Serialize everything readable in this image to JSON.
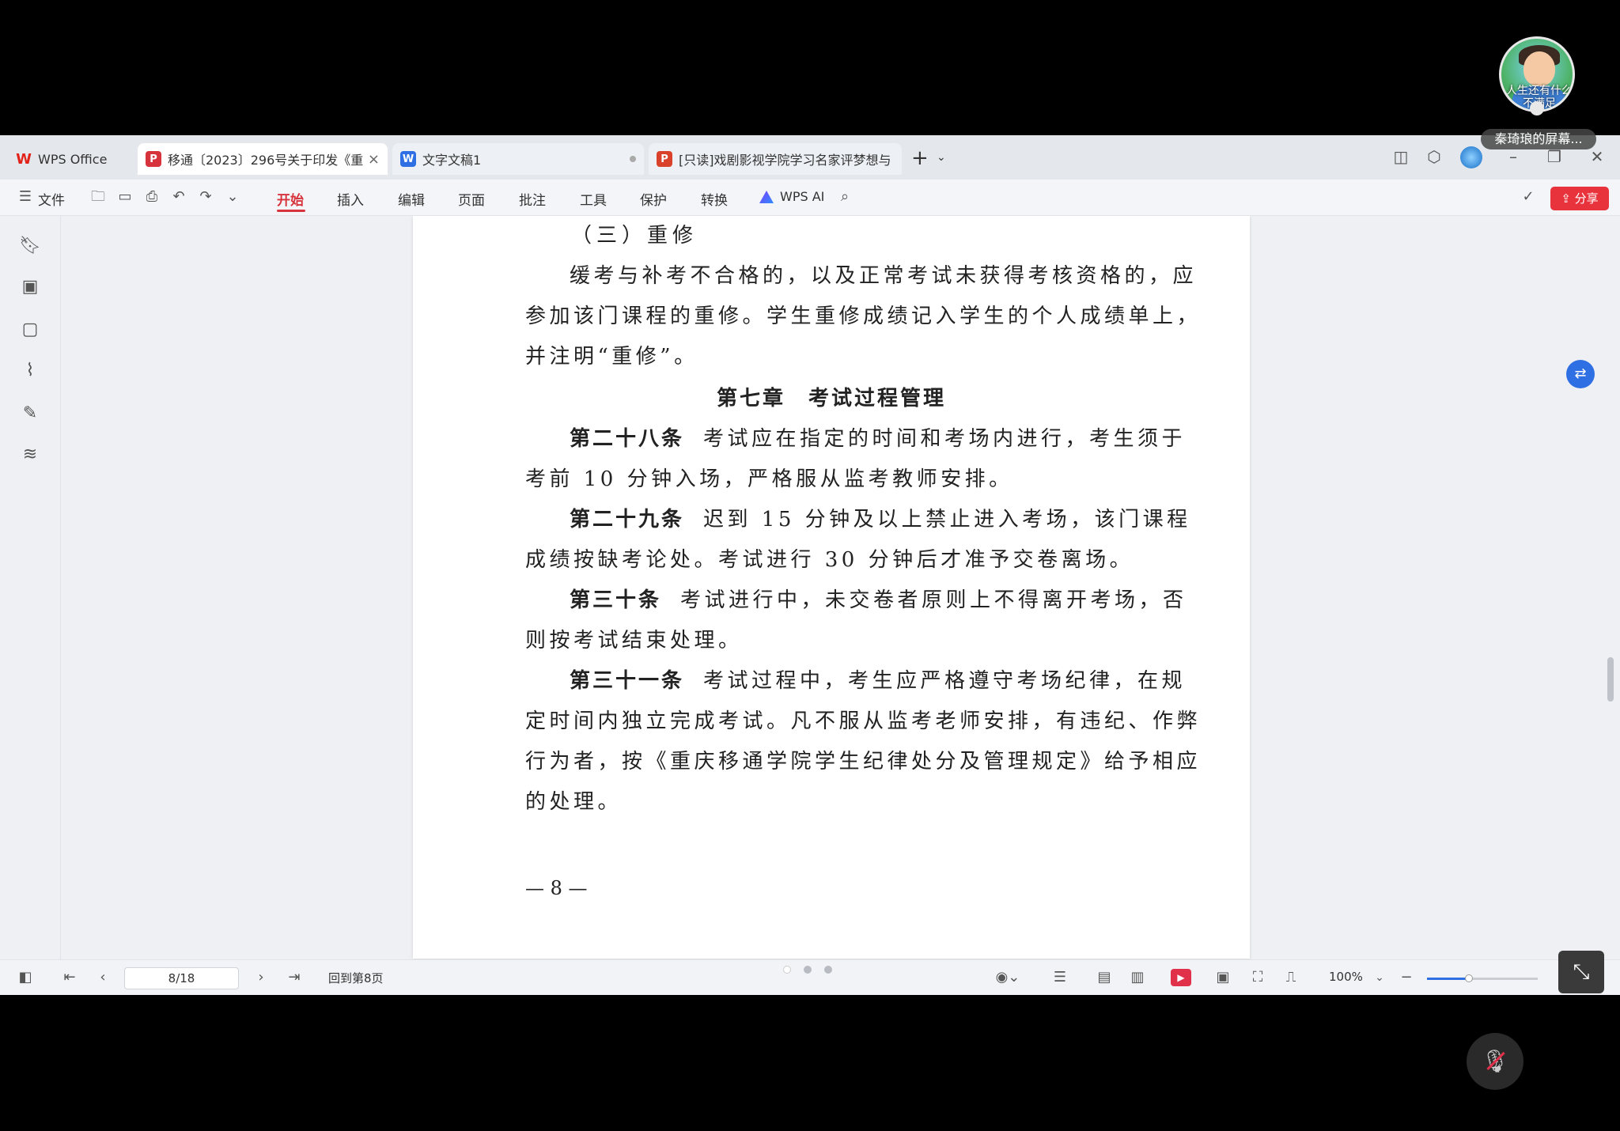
{
  "presenter": {
    "caption": "人生还有什么不满足",
    "label": "秦琦琅的屏幕..."
  },
  "tabs": {
    "home": "WPS Office",
    "doc1": "移通〔2023〕296号关于印发《重",
    "doc2": "文字文稿1",
    "doc3": "[只读]戏剧影视学院学习名家评梦想与"
  },
  "ribbon": {
    "file": "文件",
    "menus": [
      "开始",
      "插入",
      "编辑",
      "页面",
      "批注",
      "工具",
      "保护",
      "转换"
    ],
    "ai": "WPS AI",
    "share": "分享"
  },
  "document": {
    "section_title": "（三）重修",
    "para1": [
      "缓考与补考不合格的，以及正常考试未获得考核资格的，应",
      "参加该门课程的重修。学生重修成绩记入学生的个人成绩单上，",
      "并注明“重修”。"
    ],
    "chapter": "第七章　考试过程管理",
    "articles": [
      {
        "label": "第二十八条",
        "first": "考试应在指定的时间和考场内进行，考生须于",
        "rest": [
          "考前 10 分钟入场，严格服从监考教师安排。"
        ]
      },
      {
        "label": "第二十九条",
        "first": "迟到 15 分钟及以上禁止进入考场，该门课程",
        "rest": [
          "成绩按缺考论处。考试进行 30 分钟后才准予交卷离场。"
        ]
      },
      {
        "label": "第三十条",
        "first": "考试进行中，未交卷者原则上不得离开考场，否",
        "rest": [
          "则按考试结束处理。"
        ]
      },
      {
        "label": "第三十一条",
        "first": "考试过程中，考生应严格遵守考场纪律，在规",
        "rest": [
          "定时间内独立完成考试。凡不服从监考老师安排，有违纪、作弊",
          "行为者，按《重庆移通学院学生纪律处分及管理规定》给予相应",
          "的处理。"
        ]
      }
    ],
    "page_number": "— 8 —"
  },
  "status": {
    "page": "8/18",
    "back": "回到第8页",
    "zoom": "100%",
    "zoom_level": 0.38
  },
  "colors": {
    "accent": "#d7333c",
    "share": "#e8323c",
    "link": "#2f6fe4"
  }
}
